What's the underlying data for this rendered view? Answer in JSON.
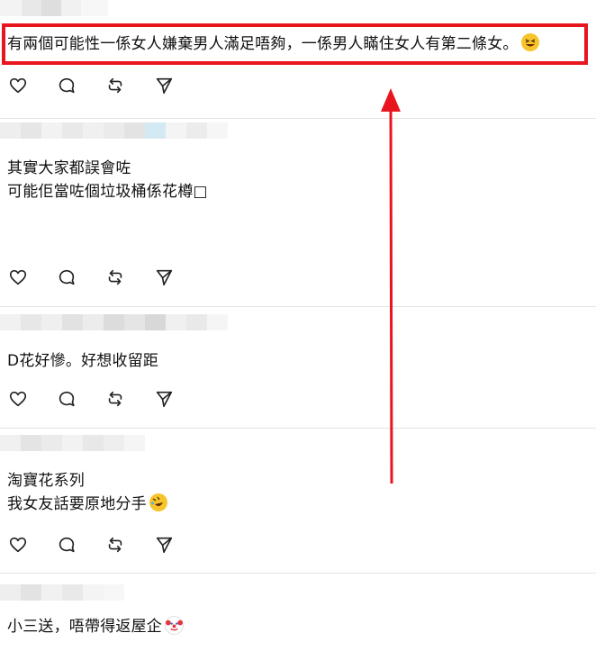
{
  "comments": [
    {
      "id": "c1",
      "lines": [
        "有兩個可能性一係女人嫌棄男人滿足唔夠，一係男人瞞住女人有第二條女。"
      ],
      "emoji": "grinning-squint-emoji"
    },
    {
      "id": "c2",
      "lines": [
        "其實大家都誤會咗",
        "可能佢當咗個垃圾桶係花樽□"
      ]
    },
    {
      "id": "c3",
      "lines": [
        "D花好慘。好想收留距"
      ]
    },
    {
      "id": "c4",
      "lines": [
        "淘寶花系列",
        "我女友話要原地分手"
      ],
      "emoji": "rolling-laughing-emoji"
    },
    {
      "id": "c5",
      "lines": [
        "小三送，唔帶得返屋企"
      ],
      "emoji": "clown-emoji"
    }
  ],
  "actions": [
    "like-icon",
    "comment-icon",
    "repost-icon",
    "share-icon"
  ],
  "annotation": {
    "color": "#e8141e"
  }
}
